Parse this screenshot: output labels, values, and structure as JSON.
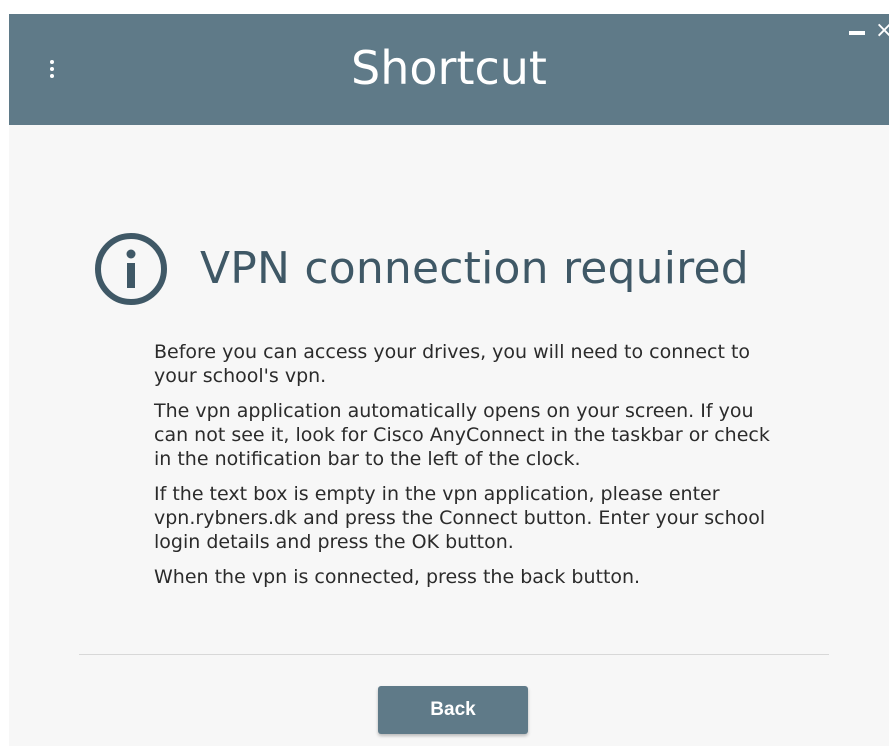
{
  "window": {
    "title": "Shortcut",
    "menu_icon": "vertical-dots-icon",
    "minimize_icon": "minimize-icon",
    "close_icon": "close-icon",
    "close_glyph": "×"
  },
  "notice": {
    "icon": "info-icon",
    "heading": "VPN connection required",
    "paragraphs": [
      "Before you can access your drives, you will need to connect to your school's vpn.",
      "The vpn application automatically opens on your screen. If you can not see it, look for Cisco AnyConnect in the taskbar or check in the notification bar to the left of the clock.",
      "If the text box is empty in the vpn application, please enter vpn.rybners.dk and press the Connect button. Enter your school login details and press the OK button.",
      "When the vpn is connected, press the back button."
    ]
  },
  "actions": {
    "back_label": "Back"
  },
  "colors": {
    "titlebar": "#5f7a88",
    "heading": "#3f5866",
    "button": "#5f7a88",
    "background": "#f7f7f7"
  }
}
